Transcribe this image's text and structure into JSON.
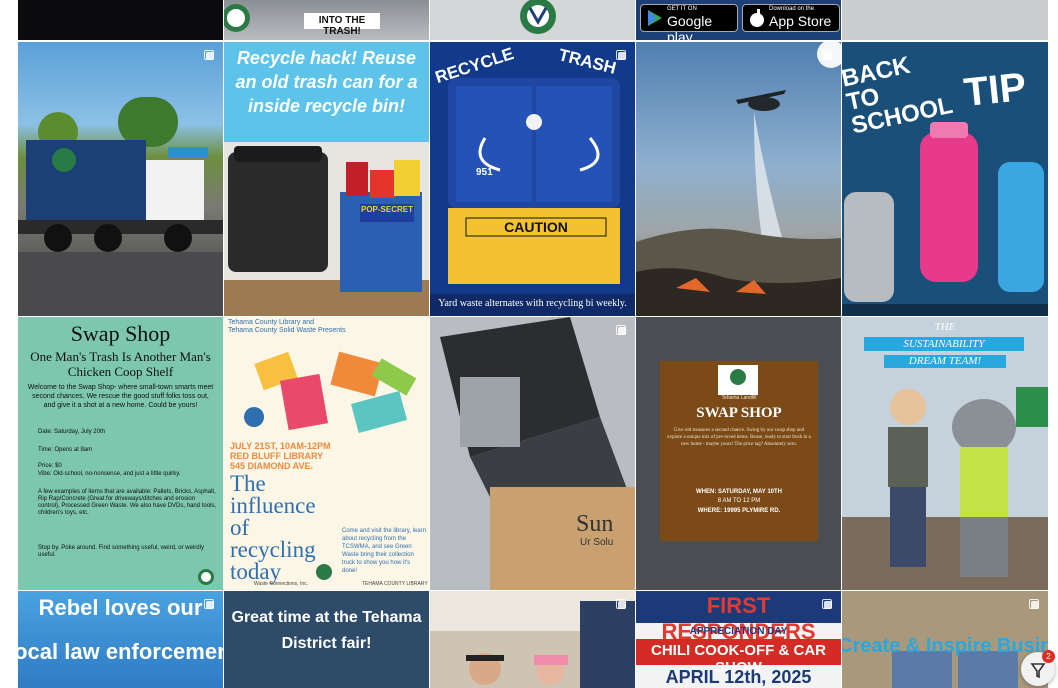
{
  "posts": {
    "row0": {
      "b": {
        "caption": "INTO THE TRASH!"
      },
      "d": {
        "google_pre": "GET IT ON",
        "google": "Google play",
        "apple_pre": "Download on the",
        "apple": "App Store"
      }
    },
    "row1": {
      "b": {
        "title": "Recycle hack! Reuse an old trash can for a inside recycle bin!",
        "box": "POP-SECRET"
      },
      "c": {
        "left": "RECYCLE",
        "right": "TRASH",
        "number": "951",
        "sign": "CAUTION",
        "caption": "Yard waste alternates with recycling bi weekly."
      },
      "e": {
        "title": "BACK TO SCHOOL",
        "tip": "TIP"
      }
    },
    "row2": {
      "a": {
        "title": "Swap Shop",
        "subtitle": "One Man's Trash Is Another Man's Chicken Coop Shelf",
        "intro": "Welcome to the Swap Shop- where small-town smarts meet second chances. We rescue the good stuff folks toss out, and give it a shot at a new home. Could be yours!",
        "date": "Date: Saturday, July 20th",
        "time": "Time: Opens at 8am",
        "price": "Price: $0",
        "vibe": "Vibe: Old-school, no-nonsense, and just a little quirky.",
        "list": "A few examples of items that are available: Pallets, Bricks, Asphalt, Rip Rap/Concrete (Great for driveways/ditches and erosion control), Processed Green Waste. We also have DVDs, hand tools, children's toys, etc.",
        "footer": "Stop by. Poke around. Find something useful, weird, or weirdly useful."
      },
      "b": {
        "top1": "Tehama County Library and",
        "top2": "Tehama County Solid Waste Presents",
        "date": "JULY 21ST, 10AM-12PM",
        "place1": "RED BLUFF LIBRARY",
        "place2": "545 DIAMOND AVE.",
        "headline": "The influence of recycling today",
        "body": "Come and visit the library, learn about recycling from the TCSWMA, and see Green Waste bring their collection truck to show you how it's done!",
        "logo1": "Waste Connections, Inc.",
        "logo2": "TEHAMA COUNTY LIBRARY"
      },
      "c": {
        "box": "Sun",
        "box2": "Ur Solu"
      },
      "d": {
        "org": "Tehama Landfill",
        "title": "SWAP SHOP",
        "body": "Give old treasures a second chance. Swing by our swap shop and explore a unique mix of pre-loved items. Reuse, ready to start fresh in a new home - maybe yours! The price tag? Absolutely zero.",
        "when": "WHEN: SATURDAY, MAY 10TH",
        "hours": "8 AM TO 12 PM",
        "where": "WHERE: 19995 PLYMIRE RD."
      },
      "e": {
        "line1": "THE",
        "line2": "SUSTAINABILITY",
        "line3": "DREAM TEAM!"
      }
    },
    "row3": {
      "a": {
        "line1": "Rebel loves our",
        "line2": "local law enforcement"
      },
      "b": {
        "line1": "Great time at the Tehama",
        "line2": "District fair!"
      },
      "d": {
        "line1": "FIRST RESPONDERS",
        "line2": "APPRECIATION DAY",
        "line3": "CHILI COOK-OFF & CAR SHOW",
        "line4": "APRIL 12th, 2025"
      },
      "e": {
        "line1": "Create & Inspire Business Su"
      }
    }
  },
  "widget": {
    "badge": "2"
  },
  "colors": {
    "brand_green": "#1f6b3a",
    "navy": "#1d3f78",
    "cyan": "#29a8e0",
    "bg": "#ffffff"
  }
}
